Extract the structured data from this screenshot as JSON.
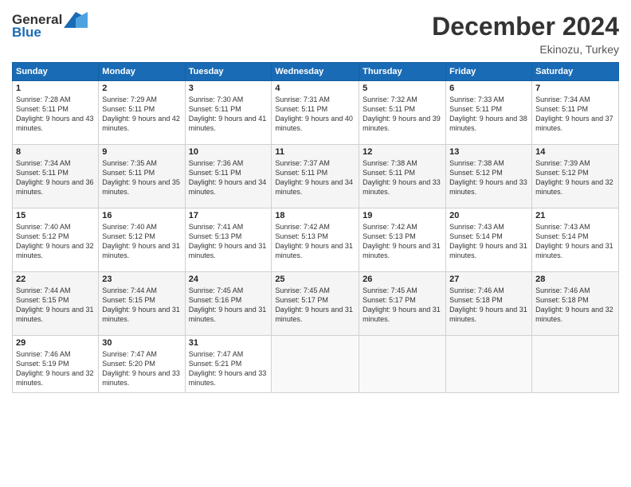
{
  "header": {
    "logo_general": "General",
    "logo_blue": "Blue",
    "month_title": "December 2024",
    "location": "Ekinozu, Turkey"
  },
  "weekdays": [
    "Sunday",
    "Monday",
    "Tuesday",
    "Wednesday",
    "Thursday",
    "Friday",
    "Saturday"
  ],
  "weeks": [
    [
      {
        "day": "1",
        "sunrise": "7:28 AM",
        "sunset": "5:11 PM",
        "daylight": "9 hours and 43 minutes."
      },
      {
        "day": "2",
        "sunrise": "7:29 AM",
        "sunset": "5:11 PM",
        "daylight": "9 hours and 42 minutes."
      },
      {
        "day": "3",
        "sunrise": "7:30 AM",
        "sunset": "5:11 PM",
        "daylight": "9 hours and 41 minutes."
      },
      {
        "day": "4",
        "sunrise": "7:31 AM",
        "sunset": "5:11 PM",
        "daylight": "9 hours and 40 minutes."
      },
      {
        "day": "5",
        "sunrise": "7:32 AM",
        "sunset": "5:11 PM",
        "daylight": "9 hours and 39 minutes."
      },
      {
        "day": "6",
        "sunrise": "7:33 AM",
        "sunset": "5:11 PM",
        "daylight": "9 hours and 38 minutes."
      },
      {
        "day": "7",
        "sunrise": "7:34 AM",
        "sunset": "5:11 PM",
        "daylight": "9 hours and 37 minutes."
      }
    ],
    [
      {
        "day": "8",
        "sunrise": "7:34 AM",
        "sunset": "5:11 PM",
        "daylight": "9 hours and 36 minutes."
      },
      {
        "day": "9",
        "sunrise": "7:35 AM",
        "sunset": "5:11 PM",
        "daylight": "9 hours and 35 minutes."
      },
      {
        "day": "10",
        "sunrise": "7:36 AM",
        "sunset": "5:11 PM",
        "daylight": "9 hours and 34 minutes."
      },
      {
        "day": "11",
        "sunrise": "7:37 AM",
        "sunset": "5:11 PM",
        "daylight": "9 hours and 34 minutes."
      },
      {
        "day": "12",
        "sunrise": "7:38 AM",
        "sunset": "5:11 PM",
        "daylight": "9 hours and 33 minutes."
      },
      {
        "day": "13",
        "sunrise": "7:38 AM",
        "sunset": "5:12 PM",
        "daylight": "9 hours and 33 minutes."
      },
      {
        "day": "14",
        "sunrise": "7:39 AM",
        "sunset": "5:12 PM",
        "daylight": "9 hours and 32 minutes."
      }
    ],
    [
      {
        "day": "15",
        "sunrise": "7:40 AM",
        "sunset": "5:12 PM",
        "daylight": "9 hours and 32 minutes."
      },
      {
        "day": "16",
        "sunrise": "7:40 AM",
        "sunset": "5:12 PM",
        "daylight": "9 hours and 31 minutes."
      },
      {
        "day": "17",
        "sunrise": "7:41 AM",
        "sunset": "5:13 PM",
        "daylight": "9 hours and 31 minutes."
      },
      {
        "day": "18",
        "sunrise": "7:42 AM",
        "sunset": "5:13 PM",
        "daylight": "9 hours and 31 minutes."
      },
      {
        "day": "19",
        "sunrise": "7:42 AM",
        "sunset": "5:13 PM",
        "daylight": "9 hours and 31 minutes."
      },
      {
        "day": "20",
        "sunrise": "7:43 AM",
        "sunset": "5:14 PM",
        "daylight": "9 hours and 31 minutes."
      },
      {
        "day": "21",
        "sunrise": "7:43 AM",
        "sunset": "5:14 PM",
        "daylight": "9 hours and 31 minutes."
      }
    ],
    [
      {
        "day": "22",
        "sunrise": "7:44 AM",
        "sunset": "5:15 PM",
        "daylight": "9 hours and 31 minutes."
      },
      {
        "day": "23",
        "sunrise": "7:44 AM",
        "sunset": "5:15 PM",
        "daylight": "9 hours and 31 minutes."
      },
      {
        "day": "24",
        "sunrise": "7:45 AM",
        "sunset": "5:16 PM",
        "daylight": "9 hours and 31 minutes."
      },
      {
        "day": "25",
        "sunrise": "7:45 AM",
        "sunset": "5:17 PM",
        "daylight": "9 hours and 31 minutes."
      },
      {
        "day": "26",
        "sunrise": "7:45 AM",
        "sunset": "5:17 PM",
        "daylight": "9 hours and 31 minutes."
      },
      {
        "day": "27",
        "sunrise": "7:46 AM",
        "sunset": "5:18 PM",
        "daylight": "9 hours and 31 minutes."
      },
      {
        "day": "28",
        "sunrise": "7:46 AM",
        "sunset": "5:18 PM",
        "daylight": "9 hours and 32 minutes."
      }
    ],
    [
      {
        "day": "29",
        "sunrise": "7:46 AM",
        "sunset": "5:19 PM",
        "daylight": "9 hours and 32 minutes."
      },
      {
        "day": "30",
        "sunrise": "7:47 AM",
        "sunset": "5:20 PM",
        "daylight": "9 hours and 33 minutes."
      },
      {
        "day": "31",
        "sunrise": "7:47 AM",
        "sunset": "5:21 PM",
        "daylight": "9 hours and 33 minutes."
      },
      null,
      null,
      null,
      null
    ]
  ]
}
